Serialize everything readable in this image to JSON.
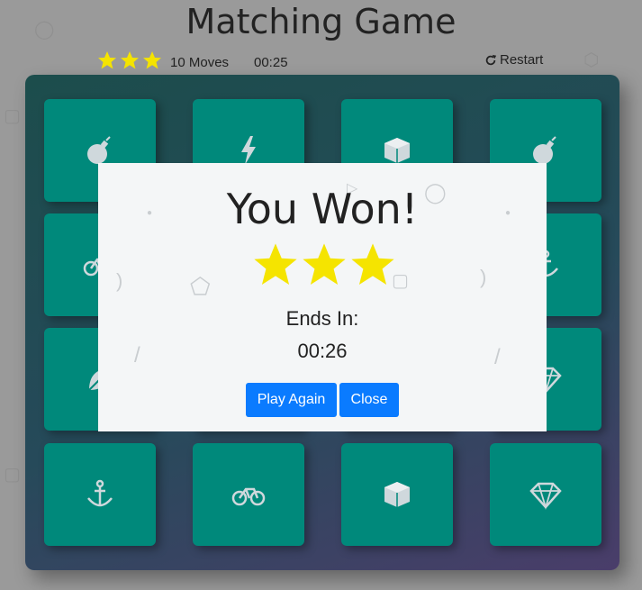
{
  "header": {
    "title": "Matching Game",
    "moves": "10 Moves",
    "timer": "00:25",
    "restart_label": "Restart",
    "star_count": 3
  },
  "colors": {
    "card": "#00897b",
    "star": "#f5e400",
    "button": "#0a7bff"
  },
  "deck": {
    "cards": [
      {
        "icon": "bomb-icon"
      },
      {
        "icon": "bolt-icon"
      },
      {
        "icon": "cube-icon"
      },
      {
        "icon": "bomb-icon"
      },
      {
        "icon": "bicycle-icon"
      },
      {
        "icon": "hidden"
      },
      {
        "icon": "hidden"
      },
      {
        "icon": "anchor-icon"
      },
      {
        "icon": "leaf-icon"
      },
      {
        "icon": "hidden"
      },
      {
        "icon": "hidden"
      },
      {
        "icon": "diamond-icon"
      },
      {
        "icon": "anchor-icon"
      },
      {
        "icon": "bicycle-icon"
      },
      {
        "icon": "cube-icon"
      },
      {
        "icon": "diamond-icon"
      }
    ]
  },
  "modal": {
    "title": "You Won!",
    "stars": 3,
    "ends_label": "Ends In:",
    "ends_time": "00:26",
    "play_again_label": "Play Again",
    "close_label": "Close"
  }
}
